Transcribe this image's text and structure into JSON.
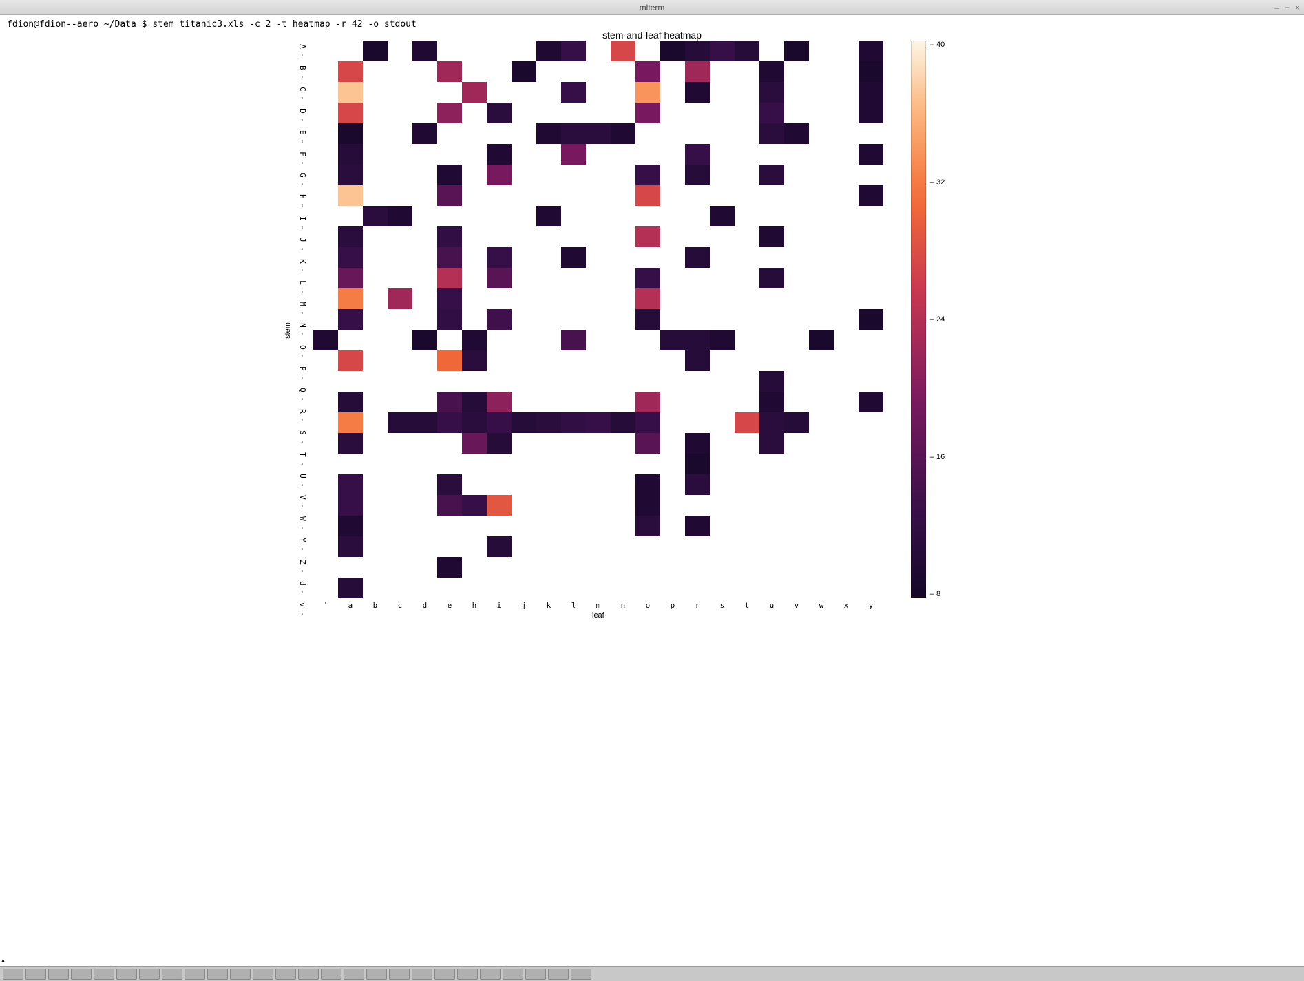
{
  "window": {
    "title": "mlterm",
    "minimize": "–",
    "maximize": "+",
    "close": "×"
  },
  "terminal": {
    "prompt": "fdion@fdion--aero ~/Data $ stem titanic3.xls -c 2 -t heatmap -r 42 -o stdout"
  },
  "chart_data": {
    "type": "heatmap",
    "title": "stem-and-leaf heatmap",
    "xlabel": "leaf",
    "ylabel": "stem",
    "x_categories": [
      "'",
      "a",
      "b",
      "c",
      "d",
      "e",
      "h",
      "i",
      "j",
      "k",
      "l",
      "m",
      "n",
      "o",
      "p",
      "r",
      "s",
      "t",
      "u",
      "v",
      "w",
      "x",
      "y"
    ],
    "y_categories": [
      "A",
      "B",
      "C",
      "D",
      "E",
      "F",
      "G",
      "H",
      "I",
      "J",
      "K",
      "L",
      "M",
      "N",
      "O",
      "P",
      "Q",
      "R",
      "S",
      "T",
      "U",
      "V",
      "W",
      "Y",
      "Z",
      "d",
      "v"
    ],
    "colorbar": {
      "min": 0,
      "max": 40,
      "ticks": [
        40,
        32,
        24,
        16,
        8
      ]
    },
    "values": [
      [
        null,
        null,
        1,
        null,
        2,
        null,
        null,
        null,
        null,
        2,
        6,
        null,
        24,
        null,
        1,
        3,
        6,
        3,
        null,
        1,
        null,
        null,
        2
      ],
      [
        null,
        24,
        null,
        null,
        null,
        18,
        null,
        null,
        1,
        null,
        null,
        null,
        null,
        14,
        null,
        18,
        null,
        null,
        2,
        null,
        null,
        null,
        1
      ],
      [
        null,
        36,
        null,
        null,
        null,
        null,
        18,
        null,
        null,
        null,
        6,
        null,
        null,
        32,
        null,
        2,
        null,
        null,
        4,
        null,
        null,
        null,
        2
      ],
      [
        null,
        24,
        null,
        null,
        null,
        16,
        null,
        4,
        null,
        null,
        null,
        null,
        null,
        14,
        null,
        null,
        null,
        null,
        6,
        null,
        null,
        null,
        2
      ],
      [
        null,
        1,
        null,
        null,
        2,
        null,
        null,
        null,
        null,
        2,
        4,
        4,
        2,
        null,
        null,
        null,
        null,
        null,
        4,
        2,
        null,
        null,
        null
      ],
      [
        null,
        3,
        null,
        null,
        null,
        null,
        null,
        2,
        null,
        null,
        14,
        null,
        null,
        null,
        null,
        6,
        null,
        null,
        null,
        null,
        null,
        null,
        2
      ],
      [
        null,
        4,
        null,
        null,
        null,
        2,
        null,
        14,
        null,
        null,
        null,
        null,
        null,
        6,
        null,
        3,
        null,
        null,
        4,
        null,
        null,
        null,
        null
      ],
      [
        null,
        36,
        null,
        null,
        null,
        10,
        null,
        null,
        null,
        null,
        null,
        null,
        null,
        24,
        null,
        null,
        null,
        null,
        null,
        null,
        null,
        null,
        2
      ],
      [
        null,
        null,
        4,
        2,
        null,
        null,
        null,
        null,
        null,
        2,
        null,
        null,
        null,
        null,
        null,
        null,
        2,
        null,
        null,
        null,
        null,
        null,
        null
      ],
      [
        null,
        4,
        null,
        null,
        null,
        5,
        null,
        null,
        null,
        null,
        null,
        null,
        null,
        20,
        null,
        null,
        null,
        null,
        2,
        null,
        null,
        null,
        null
      ],
      [
        null,
        6,
        null,
        null,
        null,
        8,
        null,
        6,
        null,
        null,
        2,
        null,
        null,
        null,
        null,
        3,
        null,
        null,
        null,
        null,
        null,
        null,
        null
      ],
      [
        null,
        12,
        null,
        null,
        null,
        20,
        null,
        10,
        null,
        null,
        null,
        null,
        null,
        6,
        null,
        null,
        null,
        null,
        3,
        null,
        null,
        null,
        null
      ],
      [
        null,
        30,
        null,
        18,
        null,
        6,
        null,
        null,
        null,
        null,
        null,
        null,
        null,
        20,
        null,
        null,
        null,
        null,
        null,
        null,
        null,
        null,
        null
      ],
      [
        null,
        6,
        null,
        null,
        null,
        5,
        null,
        7,
        null,
        null,
        null,
        null,
        null,
        3,
        null,
        null,
        null,
        null,
        null,
        null,
        null,
        null,
        1
      ],
      [
        2,
        null,
        null,
        null,
        1,
        null,
        2,
        null,
        null,
        null,
        8,
        null,
        null,
        null,
        3,
        3,
        2,
        null,
        null,
        null,
        1,
        null,
        null
      ],
      [
        null,
        24,
        null,
        null,
        null,
        28,
        4,
        null,
        null,
        null,
        null,
        null,
        null,
        null,
        null,
        3,
        null,
        null,
        null,
        null,
        null,
        null,
        null
      ],
      [
        null,
        null,
        null,
        null,
        null,
        null,
        null,
        null,
        null,
        null,
        null,
        null,
        null,
        null,
        null,
        null,
        null,
        null,
        3,
        null,
        null,
        null,
        null
      ],
      [
        null,
        3,
        null,
        null,
        null,
        8,
        3,
        16,
        null,
        null,
        null,
        null,
        null,
        18,
        null,
        null,
        null,
        null,
        2,
        null,
        null,
        null,
        2
      ],
      [
        null,
        30,
        null,
        3,
        3,
        6,
        4,
        6,
        3,
        4,
        5,
        6,
        3,
        6,
        null,
        null,
        null,
        24,
        4,
        3,
        null,
        null,
        null
      ],
      [
        null,
        4,
        null,
        null,
        null,
        null,
        12,
        3,
        null,
        null,
        null,
        null,
        null,
        10,
        null,
        2,
        null,
        null,
        4,
        null,
        null,
        null,
        null
      ],
      [
        null,
        null,
        null,
        null,
        null,
        null,
        null,
        null,
        null,
        null,
        null,
        null,
        null,
        null,
        null,
        1,
        null,
        null,
        null,
        null,
        null,
        null,
        null
      ],
      [
        null,
        6,
        null,
        null,
        null,
        4,
        null,
        null,
        null,
        null,
        null,
        null,
        null,
        2,
        null,
        4,
        null,
        null,
        null,
        null,
        null,
        null,
        null
      ],
      [
        null,
        6,
        null,
        null,
        null,
        8,
        6,
        26,
        null,
        null,
        null,
        null,
        null,
        2,
        null,
        null,
        null,
        null,
        null,
        null,
        null,
        null,
        null
      ],
      [
        null,
        2,
        null,
        null,
        null,
        null,
        null,
        null,
        null,
        null,
        null,
        null,
        null,
        4,
        null,
        2,
        null,
        null,
        null,
        null,
        null,
        null,
        null
      ],
      [
        null,
        4,
        null,
        null,
        null,
        null,
        null,
        3,
        null,
        null,
        null,
        null,
        null,
        null,
        null,
        null,
        null,
        null,
        null,
        null,
        null,
        null,
        null
      ],
      [
        null,
        null,
        null,
        null,
        null,
        2,
        null,
        null,
        null,
        null,
        null,
        null,
        null,
        null,
        null,
        null,
        null,
        null,
        null,
        null,
        null,
        null,
        null
      ],
      [
        null,
        3,
        null,
        null,
        null,
        null,
        null,
        null,
        null,
        null,
        null,
        null,
        null,
        null,
        null,
        null,
        null,
        null,
        null,
        null,
        null,
        null,
        null
      ]
    ]
  },
  "taskbar": {
    "item_count": 26
  }
}
